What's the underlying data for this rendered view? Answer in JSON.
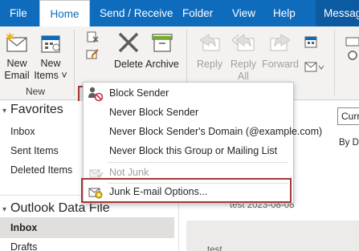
{
  "tabs": [
    {
      "label": "File",
      "active": false
    },
    {
      "label": "Home",
      "active": true
    },
    {
      "label": "Send / Receive",
      "active": false
    },
    {
      "label": "Folder",
      "active": false
    },
    {
      "label": "View",
      "active": false
    },
    {
      "label": "Help",
      "active": false
    },
    {
      "label": "Message",
      "active": false
    }
  ],
  "ribbon": {
    "new_email": {
      "line1": "New",
      "line2": "Email"
    },
    "new_items": {
      "line1": "New",
      "line2": "Items ˅"
    },
    "new_group_label": "New",
    "delete_label": "Delete",
    "archive_label": "Archive",
    "reply": {
      "line1": "Reply",
      "disabled": true
    },
    "reply_all": {
      "line1": "Reply",
      "line2": "All",
      "disabled": true
    },
    "forward": {
      "line1": "Forward",
      "disabled": true
    }
  },
  "junk_menu": {
    "items": [
      {
        "label": "Block Sender",
        "icon": "block-sender-icon",
        "disabled": false
      },
      {
        "label": "Never Block Sender",
        "disabled": false
      },
      {
        "label": "Never Block Sender's Domain (@example.com)",
        "disabled": false
      },
      {
        "label": "Never Block this Group or Mailing List",
        "disabled": false
      },
      {
        "label": "Not Junk",
        "icon": "not-junk-icon",
        "disabled": true
      },
      {
        "label": "Junk E-mail Options...",
        "icon": "junk-options-icon",
        "disabled": false
      }
    ]
  },
  "nav": {
    "favorites_title": "Favorites",
    "favorites": [
      "Inbox",
      "Sent Items",
      "Deleted Items"
    ],
    "data_file_title": "Outlook Data File",
    "data_file_items": [
      "Inbox",
      "Drafts"
    ],
    "selected": "Inbox"
  },
  "list": {
    "current_filter": "Curre",
    "sort_label": "By Da",
    "items": [
      "test 2023-08-08",
      "test"
    ]
  },
  "colors": {
    "brand": "#0f6cbd",
    "highlight": "#a4373a",
    "ribbon_bg": "#f3f2f1"
  }
}
